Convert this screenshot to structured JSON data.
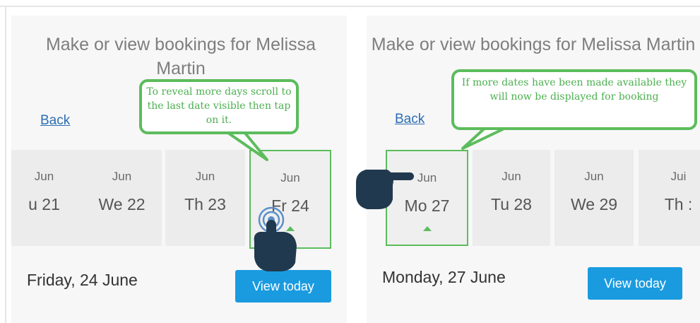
{
  "left": {
    "title": "Make or view bookings for Melissa Martin",
    "back": "Back",
    "days": [
      {
        "month": "Jun",
        "day": "u 21"
      },
      {
        "month": "Jun",
        "day": "We 22"
      },
      {
        "month": "Jun",
        "day": "Th 23"
      },
      {
        "month": "Jun",
        "day": "Fr 24"
      }
    ],
    "date_heading": "Friday, 24 June",
    "view_button": "View today",
    "callout": "To reveal more days scroll to the last date visible then tap on it."
  },
  "right": {
    "title": "Make or view bookings for Melissa Martin",
    "back": "Back",
    "days": [
      {
        "month": "Jun",
        "day": "Mo 27"
      },
      {
        "month": "Jun",
        "day": "Tu 28"
      },
      {
        "month": "Jun",
        "day": "We 29"
      },
      {
        "month": "Jui",
        "day": "Th :"
      }
    ],
    "date_heading": "Monday, 27 June",
    "view_button": "View today",
    "callout": "If more dates have been made available they will now be displayed for booking"
  },
  "colors": {
    "accent": "#5cbc5c",
    "button": "#1a9be0",
    "hand": "#21394f"
  },
  "icons": [
    "tap-hand-icon",
    "pointing-hand-icon"
  ]
}
